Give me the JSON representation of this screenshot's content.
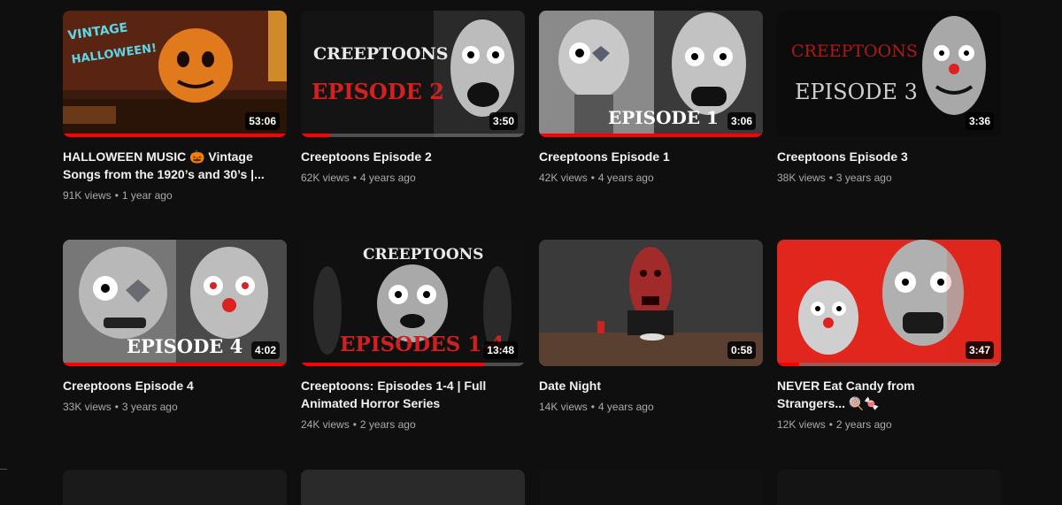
{
  "videos": [
    {
      "title": "HALLOWEEN MUSIC 🎃 Vintage Songs from the 1920’s and 30’s |...",
      "views": "91K views",
      "age": "1 year ago",
      "duration": "53:06",
      "progress": 1.0,
      "thumb_text": [
        "VINTAGE",
        "HALLOWEEN!"
      ],
      "thumb_colors": [
        "#3a1c0e",
        "#e07a1c"
      ]
    },
    {
      "title": "Creeptoons Episode 2",
      "views": "62K views",
      "age": "4 years ago",
      "duration": "3:50",
      "progress": 0.13,
      "thumb_text": [
        "CREEPTOONS",
        "EPISODE 2"
      ],
      "thumb_colors": [
        "#141414",
        "#d32020"
      ]
    },
    {
      "title": "Creeptoons Episode 1",
      "views": "42K views",
      "age": "4 years ago",
      "duration": "3:06",
      "progress": 1.0,
      "thumb_text": [
        "EPISODE 1"
      ],
      "thumb_colors": [
        "#8a8a8a",
        "#ffffff"
      ]
    },
    {
      "title": "Creeptoons Episode 3",
      "views": "38K views",
      "age": "3 years ago",
      "duration": "3:36",
      "progress": 0,
      "thumb_text": [
        "CREEPTOONS",
        "EPISODE 3"
      ],
      "thumb_colors": [
        "#0c0c0c",
        "#b01818"
      ]
    },
    {
      "title": "Creeptoons Episode 4",
      "views": "33K views",
      "age": "3 years ago",
      "duration": "4:02",
      "progress": 1.0,
      "thumb_text": [
        "EPISODE 4"
      ],
      "thumb_colors": [
        "#777777",
        "#ffffff"
      ]
    },
    {
      "title": "Creeptoons: Episodes 1-4 | Full Animated Horror Series",
      "views": "24K views",
      "age": "2 years ago",
      "duration": "13:48",
      "progress": 0.82,
      "thumb_text": [
        "CREEPTOONS",
        "EPISODES 1-4"
      ],
      "thumb_colors": [
        "#101010",
        "#d02020"
      ]
    },
    {
      "title": "Date Night",
      "views": "14K views",
      "age": "4 years ago",
      "duration": "0:58",
      "progress": 0,
      "thumb_text": [],
      "thumb_colors": [
        "#3a3a3a",
        "#a12a2a"
      ]
    },
    {
      "title": "NEVER Eat Candy from Strangers... 🍭🍬",
      "views": "12K views",
      "age": "2 years ago",
      "duration": "3:47",
      "progress": 0.1,
      "thumb_text": [],
      "thumb_colors": [
        "#e0261d",
        "#cfcfcf"
      ]
    }
  ],
  "partial_row_colors": [
    "#1a1a1a",
    "#2a2a2a",
    "#111111",
    "#141414"
  ],
  "accent": "#ff0000"
}
